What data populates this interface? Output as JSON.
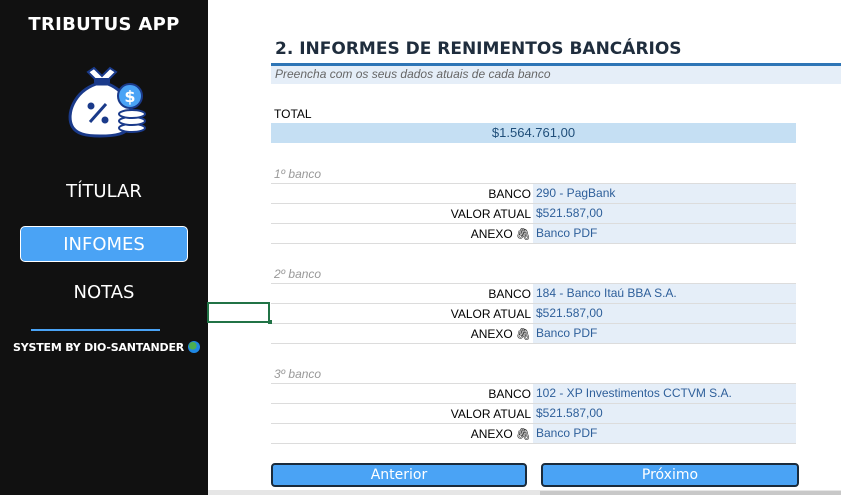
{
  "sidebar": {
    "app_title": "TRIBUTUS APP",
    "logo_icon": "money-bag-percent-icon",
    "nav": [
      {
        "label": "TÍTULAR",
        "active": false
      },
      {
        "label": "INFOMES",
        "active": true
      },
      {
        "label": "NOTAS",
        "active": false
      }
    ],
    "footer": "SYSTEM BY DIO-SANTANDER",
    "footer_icon": "globe-icon",
    "accent": "#4aa3f5"
  },
  "main": {
    "title": "2. INFORMES DE RENIMENTOS BANCÁRIOS",
    "subtitle": "Preencha com os seus dados atuais de cada banco",
    "total_label": "TOTAL",
    "total_value": "$1.564.761,00",
    "labels": {
      "banco": "BANCO",
      "valor": "VALOR ATUAL",
      "anexo": "ANEXO"
    },
    "clip_icon": "paperclip-icon",
    "banks": [
      {
        "heading": "1º banco",
        "banco": "290 - PagBank",
        "valor": "$521.587,00",
        "anexo": "Banco PDF"
      },
      {
        "heading": "2º banco",
        "banco": "184 - Banco Itaú BBA S.A.",
        "valor": "$521.587,00",
        "anexo": "Banco PDF"
      },
      {
        "heading": "3º banco",
        "banco": "102 - XP Investimentos CCTVM S.A.",
        "valor": "$521.587,00",
        "anexo": "Banco PDF"
      }
    ]
  },
  "buttons": {
    "prev": "Anterior",
    "next": "Próximo"
  }
}
